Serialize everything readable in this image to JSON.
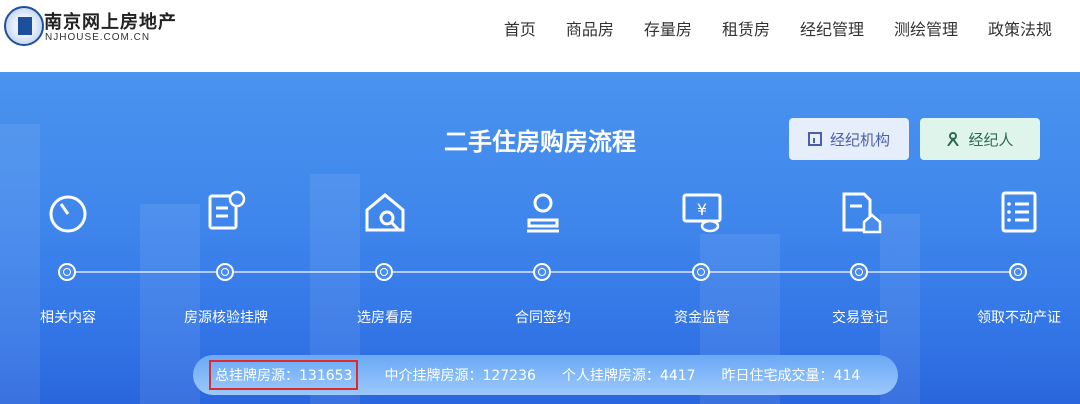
{
  "header": {
    "site_name": "南京网上房地产",
    "site_url": "NJHOUSE.COM.CN",
    "nav": [
      "首页",
      "商品房",
      "存量房",
      "租赁房",
      "经纪管理",
      "测绘管理",
      "政策法规"
    ]
  },
  "banner": {
    "title": "二手住房购房流程",
    "buttons": [
      {
        "label": "经纪机构",
        "icon": "building-chart-icon"
      },
      {
        "label": "经纪人",
        "icon": "person-icon"
      }
    ],
    "steps": [
      {
        "label": "相关内容",
        "icon": "timer-icon"
      },
      {
        "label": "房源核验挂牌",
        "icon": "document-user-icon"
      },
      {
        "label": "选房看房",
        "icon": "house-search-icon"
      },
      {
        "label": "合同签约",
        "icon": "stamp-icon"
      },
      {
        "label": "资金监管",
        "icon": "monitor-yuan-icon"
      },
      {
        "label": "交易登记",
        "icon": "document-house-icon"
      },
      {
        "label": "领取不动产证",
        "icon": "checklist-icon"
      }
    ],
    "stats": [
      "总挂牌房源：131653",
      "中介挂牌房源：127236",
      "个人挂牌房源：4417",
      "昨日住宅成交量：414"
    ]
  }
}
